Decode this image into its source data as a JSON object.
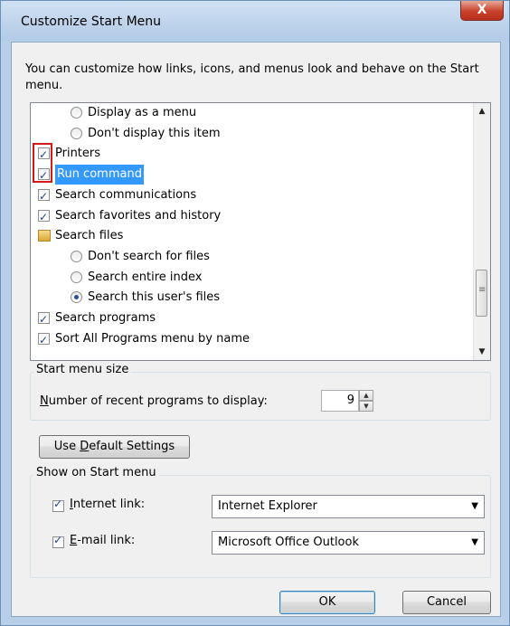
{
  "window": {
    "title": "Customize Start Menu",
    "close_glyph": "X"
  },
  "description": "You can customize how links, icons, and menus look and behave on the Start menu.",
  "tree_items": [
    {
      "type": "radio",
      "label": "Display as a menu",
      "checked": false,
      "indent": 1
    },
    {
      "type": "radio",
      "label": "Don't display this item",
      "checked": false,
      "indent": 1
    },
    {
      "type": "checkbox",
      "label": "Printers",
      "checked": true,
      "indent": 0
    },
    {
      "type": "checkbox",
      "label": "Run command",
      "checked": true,
      "indent": 0,
      "selected": true
    },
    {
      "type": "checkbox",
      "label": "Search communications",
      "checked": true,
      "indent": 0
    },
    {
      "type": "checkbox",
      "label": "Search favorites and history",
      "checked": true,
      "indent": 0
    },
    {
      "type": "folder",
      "label": "Search files",
      "indent": 0
    },
    {
      "type": "radio",
      "label": "Don't search for files",
      "checked": false,
      "indent": 1
    },
    {
      "type": "radio",
      "label": "Search entire index",
      "checked": false,
      "indent": 1
    },
    {
      "type": "radio",
      "label": "Search this user's files",
      "checked": true,
      "indent": 1
    },
    {
      "type": "checkbox",
      "label": "Search programs",
      "checked": true,
      "indent": 0
    },
    {
      "type": "checkbox",
      "label": "Sort All Programs menu by name",
      "checked": true,
      "indent": 0
    }
  ],
  "start_menu_size": {
    "legend": "Start menu size",
    "recent_label_mnemonic": "N",
    "recent_label_rest": "umber of recent programs to display:",
    "recent_value": "9"
  },
  "default_button": {
    "pre": "Use ",
    "mnemonic": "D",
    "post": "efault Settings"
  },
  "show_on_start": {
    "legend": "Show on Start menu",
    "internet": {
      "mnemonic": "I",
      "rest": "nternet link:",
      "checked": true,
      "value": "Internet Explorer"
    },
    "email": {
      "mnemonic": "E",
      "rest": "-mail link:",
      "checked": true,
      "value": "Microsoft Office Outlook"
    }
  },
  "buttons": {
    "ok": "OK",
    "cancel": "Cancel"
  },
  "colors": {
    "selection": "#3399ff",
    "highlight_box": "#d31b1b",
    "title_bar": "#b7cfe8",
    "close_button": "#c8412b"
  }
}
